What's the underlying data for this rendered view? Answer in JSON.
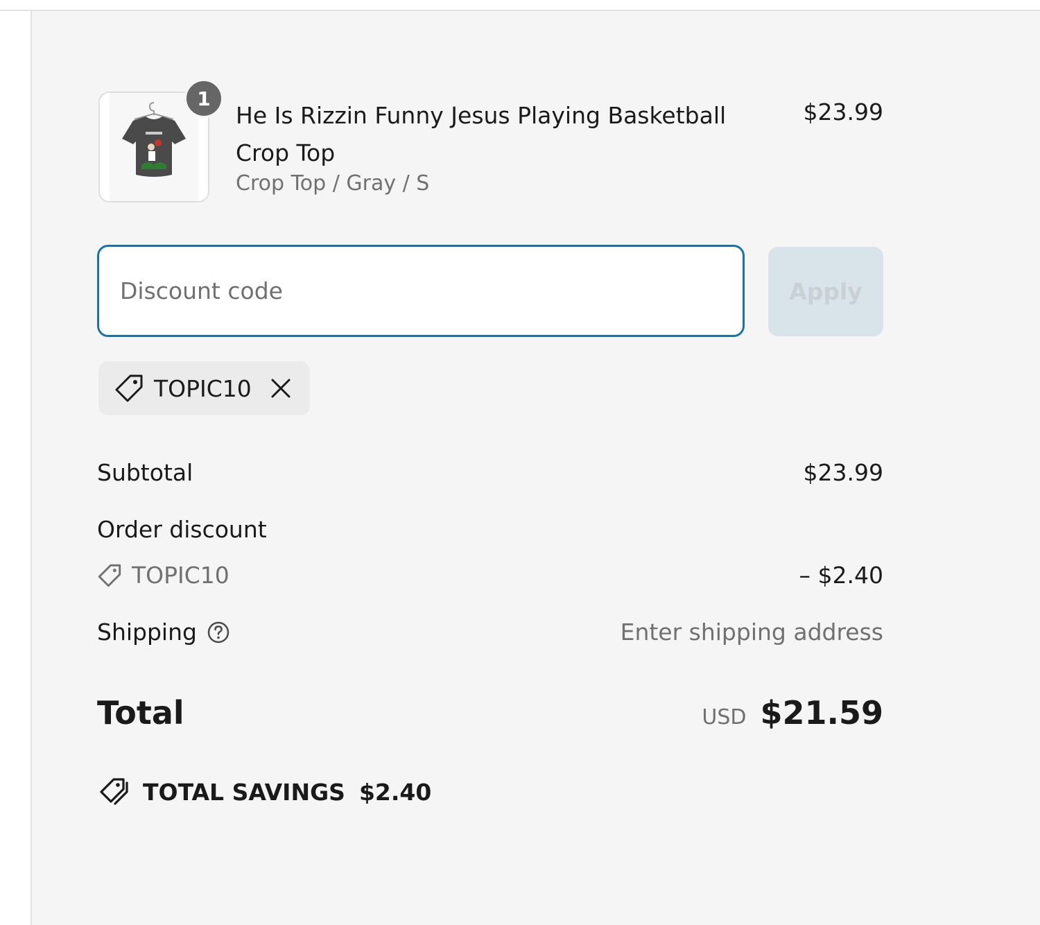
{
  "product": {
    "title": "He Is Rizzin Funny Jesus Playing Basketball Crop Top",
    "variant": "Crop Top / Gray / S",
    "price": "$23.99",
    "quantity": "1",
    "thumbnail_icon": "t-shirt-image"
  },
  "discount": {
    "placeholder": "Discount code",
    "apply_label": "Apply",
    "applied_code": "TOPIC10"
  },
  "summary": {
    "subtotal_label": "Subtotal",
    "subtotal_value": "$23.99",
    "order_discount_label": "Order discount",
    "order_discount_code": "TOPIC10",
    "order_discount_value": "– $2.40",
    "shipping_label": "Shipping",
    "shipping_value": "Enter shipping address",
    "total_label": "Total",
    "total_currency": "USD",
    "total_value": "$21.59",
    "savings_label": "TOTAL SAVINGS",
    "savings_value": "$2.40"
  },
  "colors": {
    "panel_bg": "#f5f5f5",
    "accent": "#1773b0",
    "text": "#1a1a1a",
    "muted": "#707070",
    "apply_disabled_bg": "#d9e3ea"
  }
}
